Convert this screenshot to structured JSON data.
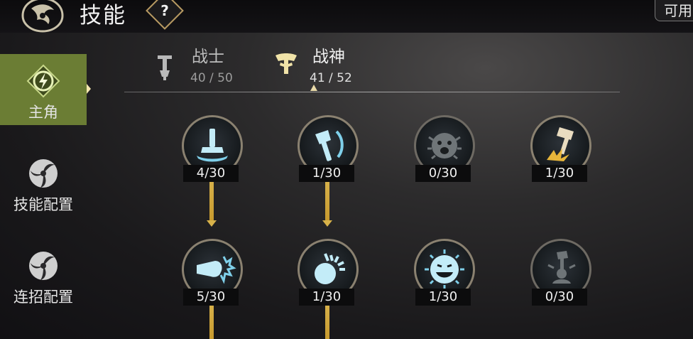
{
  "header": {
    "title": "技能",
    "help_label": "?",
    "available_label": "可用"
  },
  "sidebar": {
    "items": [
      {
        "label": "主角",
        "icon": "lightning-emblem-icon",
        "active": true
      },
      {
        "label": "技能配置",
        "icon": "triskelion-icon",
        "active": false
      },
      {
        "label": "连招配置",
        "icon": "triskelion-icon",
        "active": false
      }
    ]
  },
  "tabs": [
    {
      "name": "战士",
      "count": "40 / 50",
      "icon": "warrior-icon",
      "selected": false
    },
    {
      "name": "战神",
      "count": "41 / 52",
      "icon": "war-god-icon",
      "selected": true
    }
  ],
  "skills": {
    "row1": [
      {
        "icon": "hammer-slam-icon",
        "level": "4/30"
      },
      {
        "icon": "hammer-swing-icon",
        "level": "1/30"
      },
      {
        "icon": "roaring-face-icon",
        "level": "0/30",
        "dim": true
      },
      {
        "icon": "hammer-strike-icon",
        "level": "1/30"
      }
    ],
    "row2": [
      {
        "icon": "fist-burst-icon",
        "level": "5/30"
      },
      {
        "icon": "spiked-ball-icon",
        "level": "1/30"
      },
      {
        "icon": "laughing-sun-icon",
        "level": "1/30"
      },
      {
        "icon": "hammer-raise-icon",
        "level": "0/30",
        "dim": true
      }
    ]
  },
  "colors": {
    "accent_gold": "#d7b14a",
    "active_tab_green": "#6b7d34",
    "icon_blue": "#c3ecf8"
  }
}
